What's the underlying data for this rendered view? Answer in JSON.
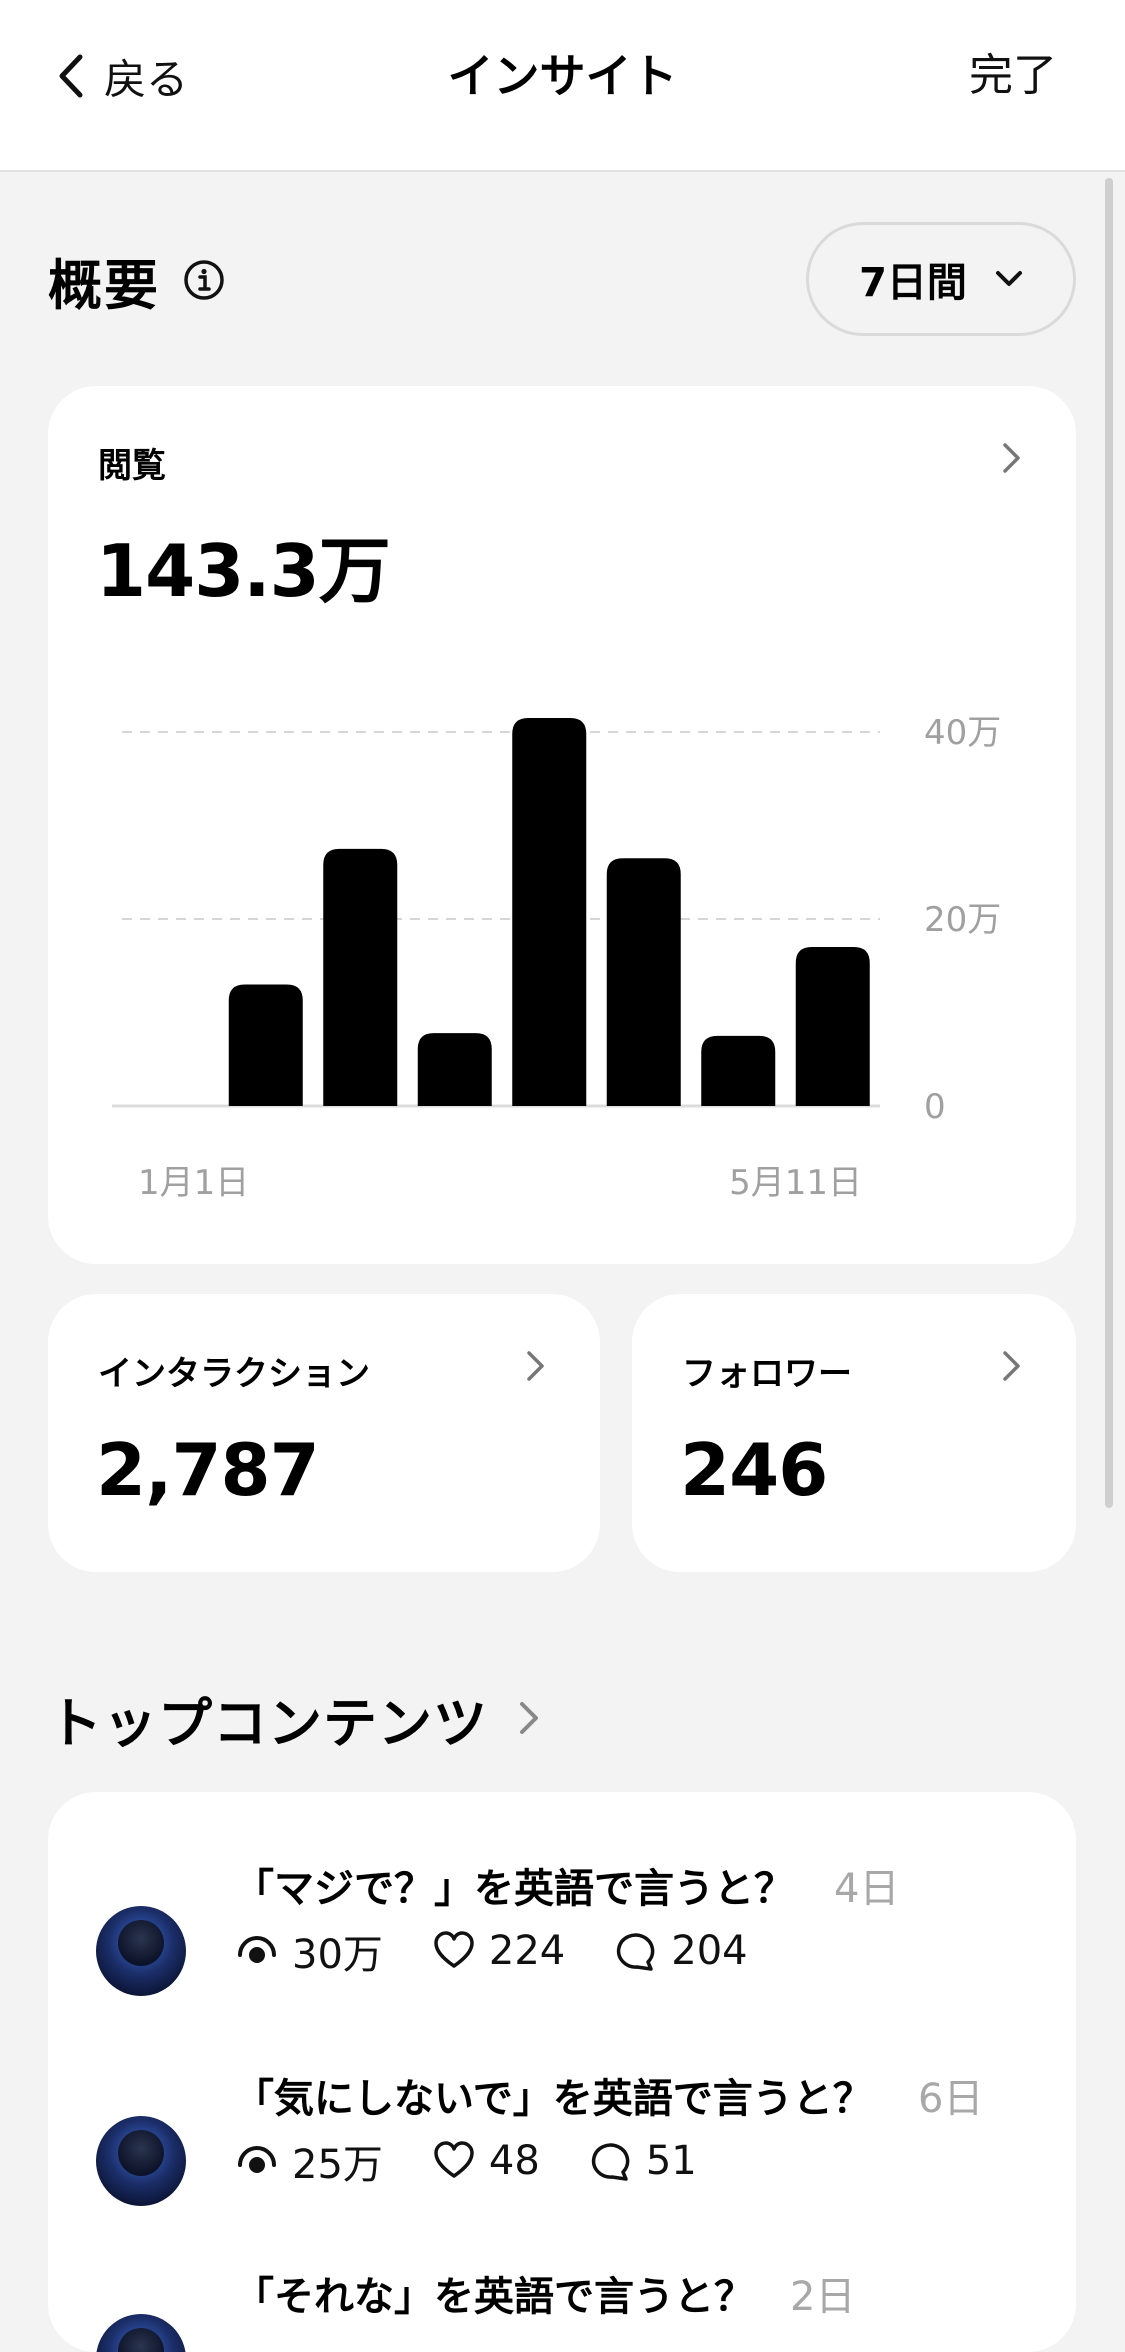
{
  "nav": {
    "back_label": "戻る",
    "title": "インサイト",
    "done_label": "完了"
  },
  "overview": {
    "title": "概要",
    "range_label": "7日間"
  },
  "views_card": {
    "label": "閲覧",
    "value": "143.3万"
  },
  "chart_data": {
    "type": "bar",
    "title": "",
    "xlabel": "",
    "ylabel": "",
    "values": [
      0,
      130000,
      275000,
      78000,
      415000,
      265000,
      75000,
      170000
    ],
    "x_tick_labels": [
      "1月1日",
      "5月11日"
    ],
    "y_ticks": [
      "0",
      "20万",
      "40万"
    ],
    "ylim": [
      0,
      400000
    ],
    "grid": true,
    "bar_color": "#000000"
  },
  "interaction_card": {
    "label": "インタラクション",
    "value": "2,787"
  },
  "followers_card": {
    "label": "フォロワー",
    "value": "246"
  },
  "top_content": {
    "title": "トップコンテンツ",
    "posts": [
      {
        "title": "「マジで？」を英語で言うと？",
        "age": "4日",
        "views": "30万",
        "likes": "224",
        "comments": "204"
      },
      {
        "title": "「気にしないで」を英語で言うと？",
        "age": "6日",
        "views": "25万",
        "likes": "48",
        "comments": "51"
      },
      {
        "title": "「それな」を英語で言うと？",
        "age": "2日",
        "views": "",
        "likes": "",
        "comments": ""
      }
    ]
  },
  "icons": [
    "back-chevron-icon",
    "info-icon",
    "chevron-down-icon",
    "chevron-right-icon",
    "views-icon",
    "heart-icon",
    "comment-icon"
  ]
}
